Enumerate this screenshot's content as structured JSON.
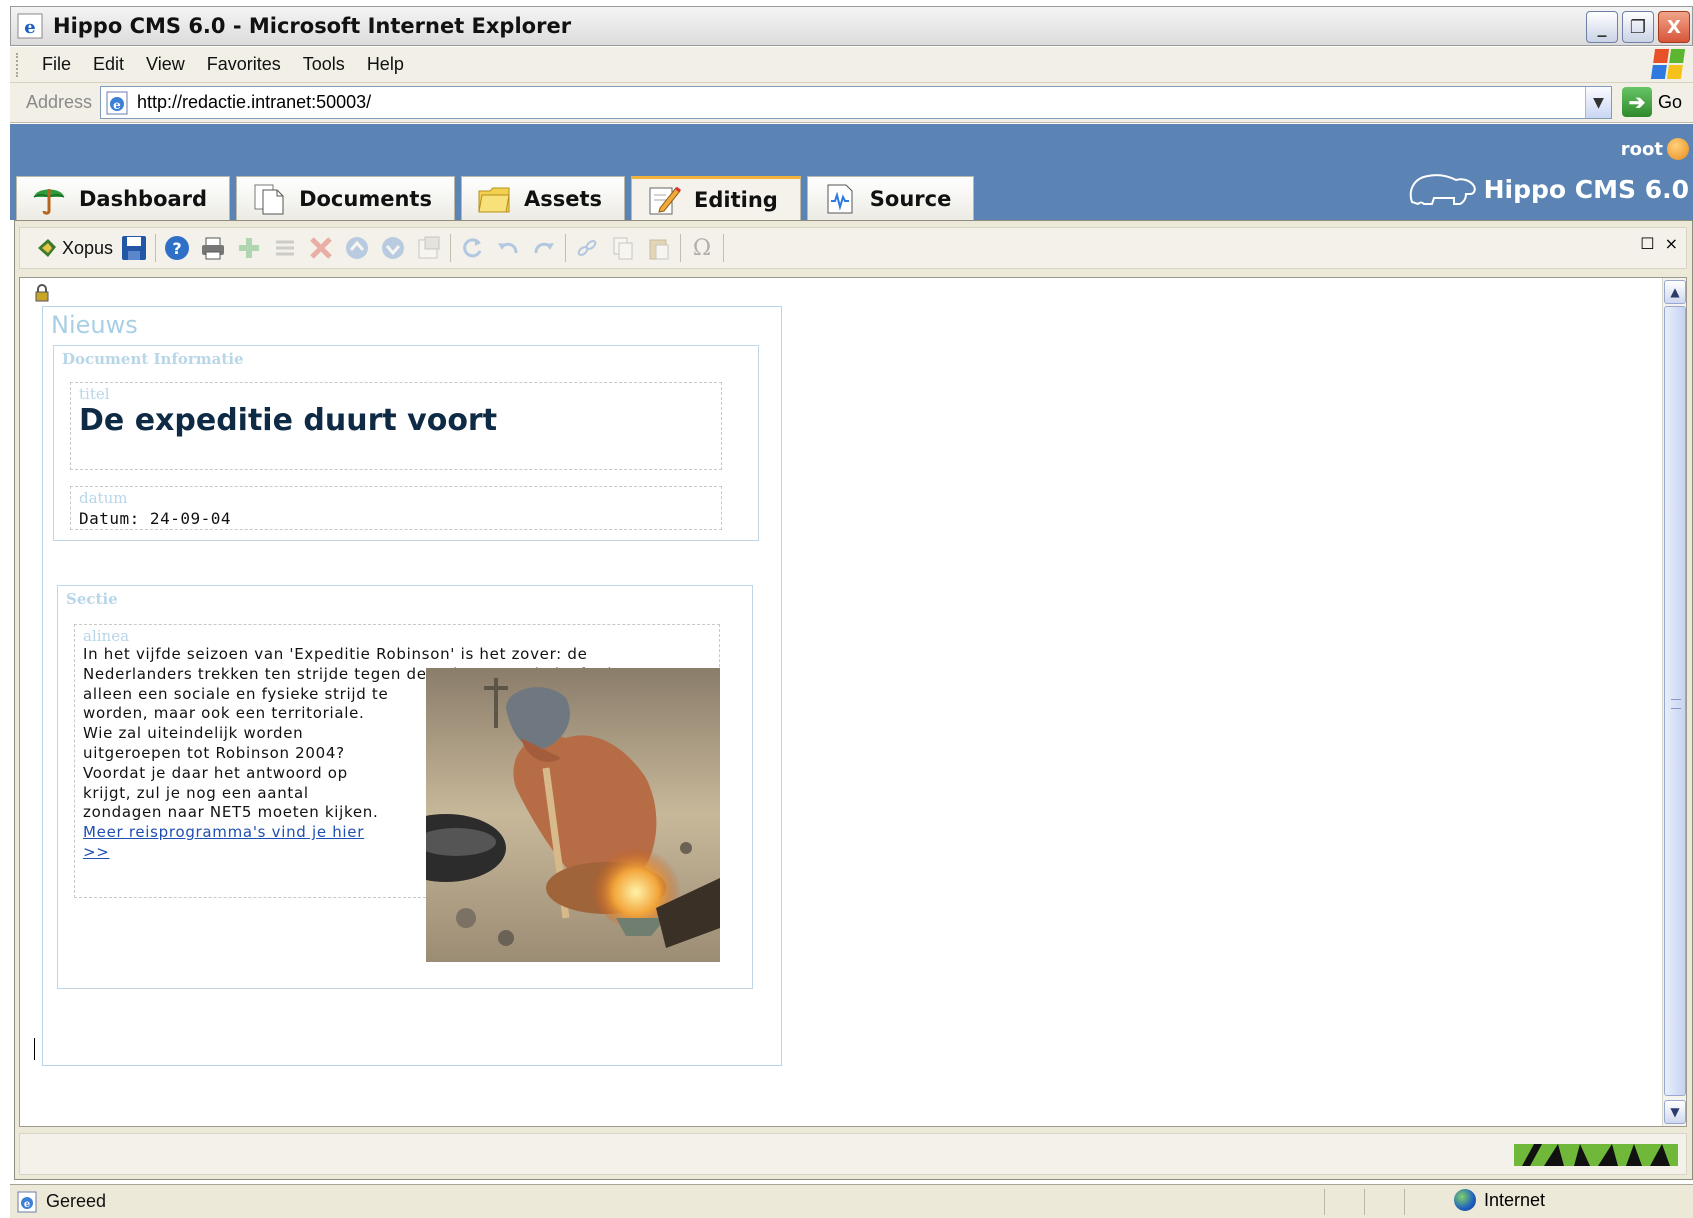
{
  "window": {
    "title": "Hippo CMS 6.0 - Microsoft Internet Explorer",
    "minimize": "_",
    "restore": "❐",
    "close": "X"
  },
  "menu": {
    "items": [
      "File",
      "Edit",
      "View",
      "Favorites",
      "Tools",
      "Help"
    ]
  },
  "address": {
    "label": "Address",
    "url": "http://redactie.intranet:50003/",
    "go_label": "Go"
  },
  "cms": {
    "user": "root",
    "brand": "Hippo CMS 6.0",
    "tabs": [
      {
        "label": "Dashboard",
        "icon": "umbrella-icon",
        "active": false
      },
      {
        "label": "Documents",
        "icon": "documents-icon",
        "active": false
      },
      {
        "label": "Assets",
        "icon": "folder-icon",
        "active": false
      },
      {
        "label": "Editing",
        "icon": "edit-pencil-icon",
        "active": true
      },
      {
        "label": "Source",
        "icon": "source-icon",
        "active": false
      }
    ]
  },
  "toolbar": {
    "xopus_label": "Xopus",
    "maximize": "☐",
    "close": "×"
  },
  "document": {
    "doc_type": "Nieuws",
    "info_section": "Document Informatie",
    "titel_label": "titel",
    "titel_value": "De expeditie duurt voort",
    "datum_label": "datum",
    "datum_value": "Datum: 24-09-04",
    "sectie_label": "Sectie",
    "alinea_label": "alinea",
    "alinea_line1": "In het vijfde seizoen van 'Expeditie Robinson' is het zover: de",
    "alinea_line2": "Nederlanders trekken ten strijde tegen de Belgen! Dat belooft niet",
    "alinea_rest": "alleen een sociale en fysieke strijd te worden, maar ook een territoriale. Wie zal uiteindelijk worden uitgeroepen tot Robinson 2004? Voordat je daar het antwoord op krijgt, zul je nog een aantal zondagen naar NET5 moeten kijken.",
    "alinea_link": "Meer reisprogramma's vind je hier >>"
  },
  "status": {
    "text": "Gereed",
    "zone": "Internet"
  },
  "colors": {
    "cms_header": "#5b84b5",
    "active_tab_accent": "#f1b33c",
    "field_label": "#b7d6e8",
    "title_text": "#0e2a45"
  }
}
